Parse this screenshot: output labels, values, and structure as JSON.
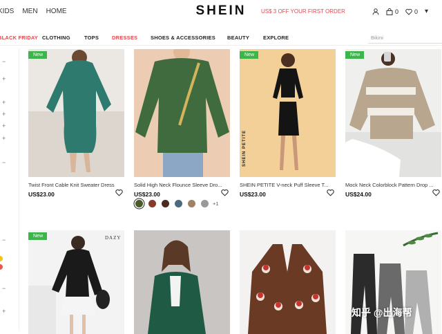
{
  "header": {
    "nav": [
      "KIDS",
      "MEN",
      "HOME"
    ],
    "logo": "SHEIN",
    "promo": "US$ 3 OFF YOUR FIRST ORDER",
    "bag_count": "0",
    "wishlist_count": "0"
  },
  "categories": [
    "BLACK FRIDAY",
    "CLOTHING",
    "TOPS",
    "DRESSES",
    "SHOES & ACCESSORIES",
    "BEAUTY",
    "EXPLORE"
  ],
  "search": {
    "placeholder": "Bikini"
  },
  "sidebar": {
    "toggles": [
      "−",
      "+",
      "+",
      "+",
      "+",
      "+",
      "−",
      "−",
      "−",
      "+"
    ]
  },
  "products": [
    {
      "badge": "New",
      "title": "Twist Front Cable Knit Sweater Dress",
      "price": "US$23.00"
    },
    {
      "badge": "",
      "title": "Solid High Neck Flounce Sleeve Dro...",
      "price": "US$23.00",
      "more_colors": "+1"
    },
    {
      "badge": "New",
      "title": "SHEIN PETITE V-neck Puff Sleeve T...",
      "price": "US$23.00"
    },
    {
      "badge": "New",
      "title": "Mock Neck Colorblock Pattern Drop ...",
      "price": "US$24.00"
    },
    {
      "badge": "New"
    },
    {
      "badge": ""
    },
    {
      "badge": ""
    },
    {
      "badge": ""
    }
  ],
  "image_texts": {
    "petite_brand": "SHEIN PETITE",
    "dazy_brand": "DAZY"
  },
  "watermark": "知乎 @出海帮",
  "colors": {
    "accent_red": "#e5484d",
    "badge_green": "#3cb54a",
    "swatches": [
      "#4a5a2c",
      "#8a3a2a",
      "#4a2a22",
      "#4a6a82",
      "#a08266",
      "#9a9a9a"
    ]
  }
}
